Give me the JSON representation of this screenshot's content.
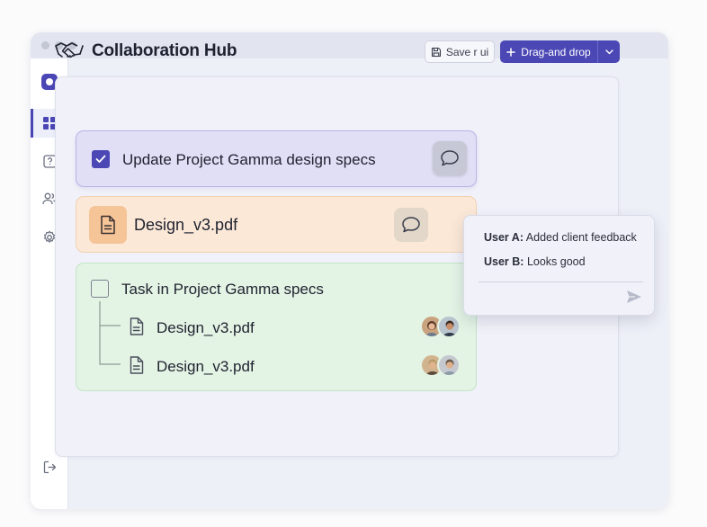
{
  "app": {
    "title": "Collaboration Hub"
  },
  "toolbar": {
    "save_label": "Save r ui",
    "primary_label": "Drag-and drop"
  },
  "sidebar": {
    "items": [
      "dashboard",
      "help",
      "users",
      "settings",
      "logout"
    ]
  },
  "tasks": [
    {
      "label": "Update Project Gamma design specs",
      "checked": true
    },
    {
      "label": "Design_v3.pdf",
      "type": "file"
    },
    {
      "label": "Task in Project Gamma specs",
      "checked": false,
      "children": [
        {
          "label": "Design_v3.pdf"
        },
        {
          "label": "Design_v3.pdf"
        }
      ]
    }
  ],
  "comments": [
    {
      "user": "User A:",
      "text": "Added client feedback"
    },
    {
      "user": "User B:",
      "text": "Looks good"
    }
  ],
  "colors": {
    "accent": "#4b48b5",
    "task_bg": "#e1dff5",
    "file_bg": "#fbe8d7",
    "group_bg": "#e3f3e4"
  }
}
